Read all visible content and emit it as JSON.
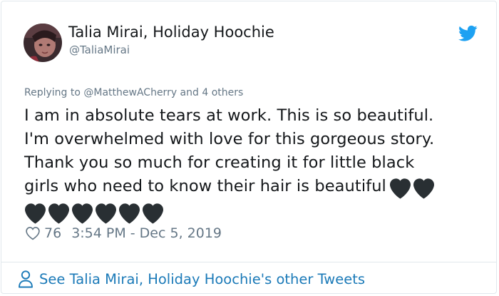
{
  "author": {
    "name": "Talia Mirai, Holiday Hoochie",
    "handle": "@TaliaMirai"
  },
  "reply": {
    "prefix": "Replying to ",
    "mention": "@MatthewACherry",
    "suffix": " and 4 others"
  },
  "tweet": {
    "line1": "I am in absolute tears at work. This is so beautiful.",
    "line2": "I'm overwhelmed with love for this gorgeous story.",
    "line3": "Thank you so much for creating it for little black",
    "line4": "girls who need to know their hair is beautiful"
  },
  "meta": {
    "likes": "76",
    "timestamp": "3:54 PM - Dec 5, 2019"
  },
  "footer": {
    "see_more": "See Talia Mirai, Holiday Hoochie's other Tweets"
  },
  "icons": {
    "bird": "twitter-bird-icon",
    "heart_outline": "heart-outline-icon",
    "heart_emoji": "black-heart-emoji",
    "person": "person-icon"
  },
  "colors": {
    "twitter_blue": "#1da1f2",
    "link_blue": "#1b7ab8",
    "secondary_text": "#657786",
    "heart_emoji": "#292f33"
  }
}
